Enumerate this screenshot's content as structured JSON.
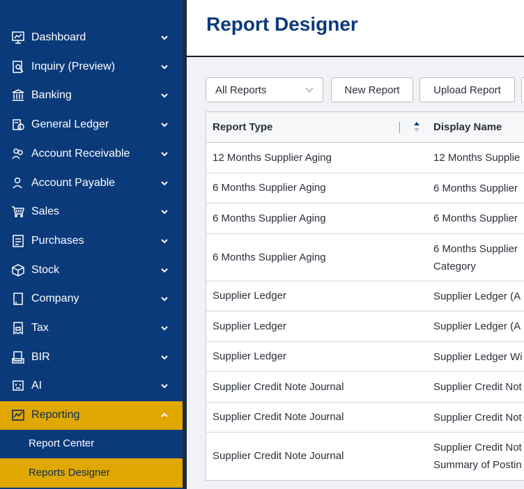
{
  "sidebar": {
    "items": [
      {
        "label": "Dashboard",
        "icon": "dashboard-icon"
      },
      {
        "label": "Inquiry (Preview)",
        "icon": "inquiry-icon"
      },
      {
        "label": "Banking",
        "icon": "bank-icon"
      },
      {
        "label": "General Ledger",
        "icon": "ledger-icon"
      },
      {
        "label": "Account Receivable",
        "icon": "receivable-icon"
      },
      {
        "label": "Account Payable",
        "icon": "payable-icon"
      },
      {
        "label": "Sales",
        "icon": "cart-icon"
      },
      {
        "label": "Purchases",
        "icon": "purchases-icon"
      },
      {
        "label": "Stock",
        "icon": "box-icon"
      },
      {
        "label": "Company",
        "icon": "company-icon"
      },
      {
        "label": "Tax",
        "icon": "tax-icon"
      },
      {
        "label": "BIR",
        "icon": "bir-icon"
      },
      {
        "label": "AI",
        "icon": "ai-icon"
      },
      {
        "label": "Reporting",
        "icon": "chart-icon"
      }
    ],
    "active_item": "Reporting",
    "subitems": [
      {
        "label": "Report Center"
      },
      {
        "label": "Reports Designer"
      }
    ],
    "active_subitem": "Reports Designer",
    "accent_color": "#e0a800",
    "bg_color": "#0b3a7a"
  },
  "header": {
    "title": "Report Designer"
  },
  "toolbar": {
    "filter_value": "All Reports",
    "new_label": "New Report",
    "upload_label": "Upload Report"
  },
  "table": {
    "columns": [
      "Report Type",
      "Display Name"
    ],
    "rows": [
      {
        "type": "12 Months Supplier Aging",
        "name": [
          "12 Months Supplie"
        ]
      },
      {
        "type": "6 Months Supplier Aging",
        "name": [
          "6 Months Supplier"
        ]
      },
      {
        "type": "6 Months Supplier Aging",
        "name": [
          "6 Months Supplier"
        ]
      },
      {
        "type": "6 Months Supplier Aging",
        "name": [
          "6 Months Supplier",
          "Category"
        ]
      },
      {
        "type": "Supplier Ledger",
        "name": [
          "Supplier Ledger (A"
        ]
      },
      {
        "type": "Supplier Ledger",
        "name": [
          "Supplier Ledger (A"
        ]
      },
      {
        "type": "Supplier Ledger",
        "name": [
          "Supplier Ledger Wi"
        ]
      },
      {
        "type": "Supplier Credit Note Journal",
        "name": [
          "Supplier Credit Not"
        ]
      },
      {
        "type": "Supplier Credit Note Journal",
        "name": [
          "Supplier Credit Not"
        ]
      },
      {
        "type": "Supplier Credit Note Journal",
        "name": [
          "Supplier Credit Not",
          "Summary of Postin"
        ]
      }
    ]
  }
}
